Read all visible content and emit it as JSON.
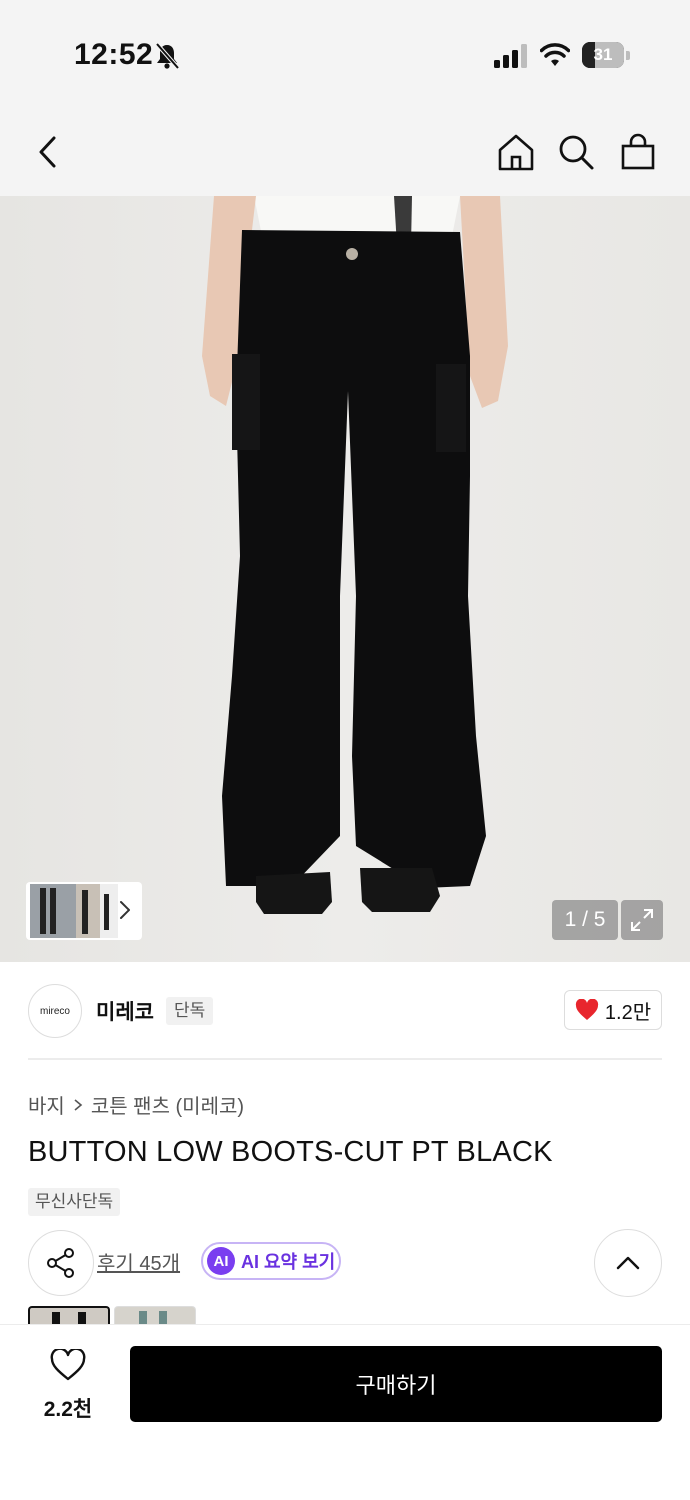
{
  "status_bar": {
    "time": "12:52",
    "battery_level": "31",
    "battery_fraction": 0.31,
    "icons": [
      "bell-muted-icon",
      "signal-icon",
      "wifi-icon",
      "battery-icon"
    ]
  },
  "nav": {
    "icons": [
      "back-chevron-icon",
      "home-icon",
      "search-icon",
      "shopping-bag-icon"
    ]
  },
  "gallery": {
    "counter": "1 / 5",
    "current": 1,
    "total": 5,
    "icons": [
      "chevron-right-icon",
      "expand-icon"
    ]
  },
  "brand": {
    "logo_text": "mireco",
    "name": "미레코",
    "tag": "단독",
    "likes": "1.2만"
  },
  "product": {
    "breadcrumb": [
      "바지",
      "코튼 팬츠 (미레코)"
    ],
    "title": "BUTTON LOW BOOTS-CUT PT BLACK",
    "exclusive_tag": "무신사단독",
    "reviews": "후기 45개",
    "ai_badge": "AI",
    "ai_summary": "AI 요약 보기"
  },
  "bottom_bar": {
    "wish_count": "2.2천",
    "buy_label": "구매하기"
  },
  "colors": {
    "accent_purple": "#7a3ef0",
    "heart_red": "#e8262d",
    "buy_button": "#000000"
  }
}
